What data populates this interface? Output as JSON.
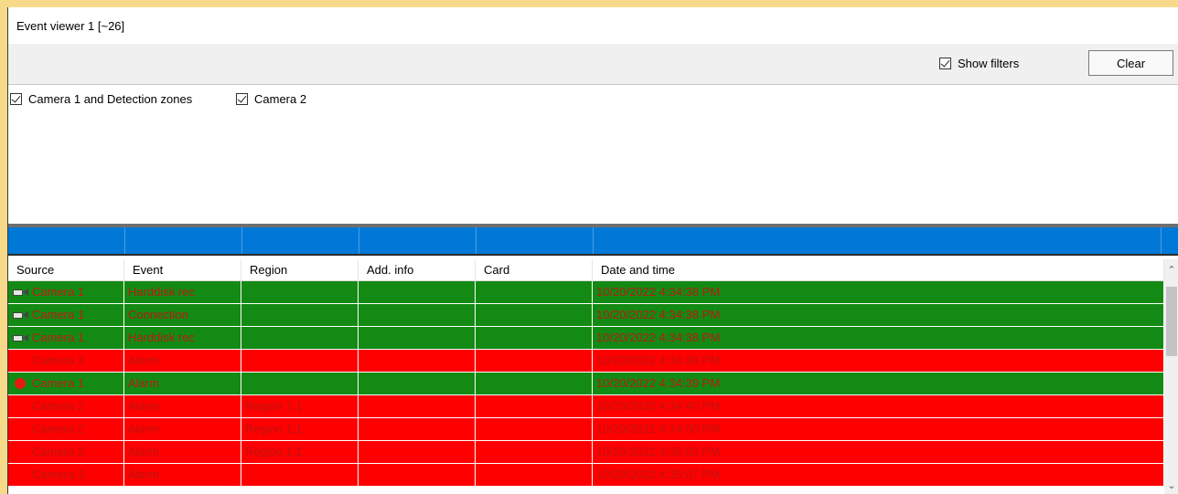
{
  "window": {
    "title": "Event viewer 1 [~26]"
  },
  "toolbar": {
    "show_filters_label": "Show filters",
    "show_filters_checked": true,
    "clear_label": "Clear"
  },
  "filters": [
    {
      "label": "Camera 1 and Detection zones",
      "checked": true
    },
    {
      "label": "Camera 2",
      "checked": true
    }
  ],
  "table": {
    "columns": [
      "Source",
      "Event",
      "Region",
      "Add. info",
      "Card",
      "Date and time"
    ],
    "rows": [
      {
        "source": "Camera 1",
        "icon": "camera-icon",
        "event": "Harddisk rec",
        "region": "",
        "add_info": "",
        "card": "",
        "datetime": "10/20/2022 4:34:38 PM",
        "color": "green"
      },
      {
        "source": "Camera 1",
        "icon": "camera-icon",
        "event": "Connection",
        "region": "",
        "add_info": "",
        "card": "",
        "datetime": "10/20/2022 4:34:38 PM",
        "color": "green"
      },
      {
        "source": "Camera 1",
        "icon": "camera-icon",
        "event": "Harddisk rec",
        "region": "",
        "add_info": "",
        "card": "",
        "datetime": "10/20/2022 4:34:38 PM",
        "color": "green"
      },
      {
        "source": "Camera 3",
        "icon": "",
        "event": "Alarm",
        "region": "",
        "add_info": "",
        "card": "",
        "datetime": "10/20/2022 4:34:39 PM",
        "color": "red"
      },
      {
        "source": "Camera 1",
        "icon": "alarm-dot-icon",
        "event": "Alarm",
        "region": "",
        "add_info": "",
        "card": "",
        "datetime": "10/20/2022 4:34:39 PM",
        "color": "green"
      },
      {
        "source": "Camera 2",
        "icon": "",
        "event": "Alarm",
        "region": "Region 1.1",
        "add_info": "",
        "card": "",
        "datetime": "10/20/2022 4:34:40 PM",
        "color": "red"
      },
      {
        "source": "Camera 2",
        "icon": "",
        "event": "Alarm",
        "region": "Region 1.1",
        "add_info": "",
        "card": "",
        "datetime": "10/20/2022 4:34:50 PM",
        "color": "red"
      },
      {
        "source": "Camera 2",
        "icon": "",
        "event": "Alarm",
        "region": "Region 1.1",
        "add_info": "",
        "card": "",
        "datetime": "10/20/2022 4:35:03 PM",
        "color": "red"
      },
      {
        "source": "Camera 3",
        "icon": "",
        "event": "Alarm",
        "region": "",
        "add_info": "",
        "card": "",
        "datetime": "10/20/2022 4:35:07 PM",
        "color": "red"
      }
    ]
  },
  "colors": {
    "row_green": "#138a13",
    "row_red": "#ff0000",
    "header_bar_blue": "#0078d7"
  }
}
